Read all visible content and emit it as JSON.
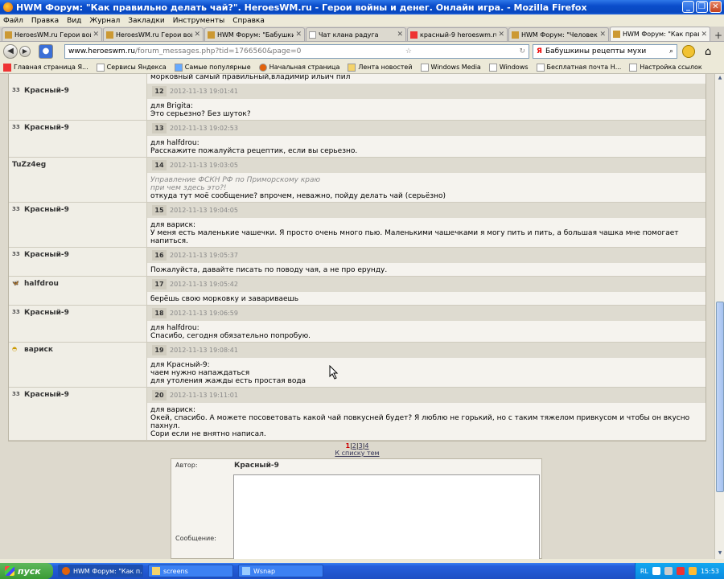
{
  "window": {
    "title": "HWM Форум: \"Как правильно делать чай?\". HeroesWM.ru - Герои войны и денег. Онлайн игра. - Mozilla Firefox"
  },
  "menu": [
    "Файл",
    "Правка",
    "Вид",
    "Журнал",
    "Закладки",
    "Инструменты",
    "Справка"
  ],
  "tabs": [
    {
      "label": "HeroesWM.ru Герои войн..."
    },
    {
      "label": "HeroesWM.ru Герои войн..."
    },
    {
      "label": "HWM Форум: \"Бабушкин..."
    },
    {
      "label": "Чат клана радуга"
    },
    {
      "label": "красный-9 heroeswm.ru-..."
    },
    {
      "label": "HWM Форум: \"Человек и..."
    },
    {
      "label": "HWM Форум: \"Как прави..."
    }
  ],
  "nav": {
    "url_domain": "www.heroeswm.ru",
    "url_path": "/forum_messages.php?tid=1766560&page=0",
    "search_value": "Бабушкины рецепты мухи"
  },
  "bookmarks": [
    "Главная страница Я...",
    "Сервисы Яндекса",
    "Самые популярные",
    "Начальная страница",
    "Лента новостей",
    "Windows Media",
    "Windows",
    "Бесплатная почта Н...",
    "Настройка ссылок"
  ],
  "top_partial_text": "морковный самый правильный,владимир ильич пил",
  "posts": [
    {
      "author": "Красный-9",
      "icon": "clan-33",
      "num": "12",
      "date": "2012-11-13 19:01:41",
      "quote": [],
      "lines": [
        "для Brigita:",
        "Это серьезно? Без шуток?"
      ]
    },
    {
      "author": "Красный-9",
      "icon": "clan-33",
      "num": "13",
      "date": "2012-11-13 19:02:53",
      "quote": [],
      "lines": [
        "для halfdrou:",
        "Расскажите пожалуйста рецептик, если вы серьезно."
      ]
    },
    {
      "author": "TuZz4eg",
      "icon": "",
      "num": "14",
      "date": "2012-11-13 19:03:05",
      "quote": [
        "Управление ФСКН РФ по Приморскому краю",
        "при чем здесь это?!"
      ],
      "lines": [
        "откуда тут моё сообщение? впрочем, неважно, пойду делать чай (серьёзно)"
      ]
    },
    {
      "author": "Красный-9",
      "icon": "clan-33",
      "num": "15",
      "date": "2012-11-13 19:04:05",
      "quote": [],
      "lines": [
        "для вариск:",
        "У меня есть маленькие чашечки. Я просто очень много пью. Маленькими чашечками я могу пить и пить, а большая чашка мне помогает напиться."
      ]
    },
    {
      "author": "Красный-9",
      "icon": "clan-33",
      "num": "16",
      "date": "2012-11-13 19:05:37",
      "quote": [],
      "lines": [
        "Пожалуйста, давайте писать по поводу чая, а не про ерунду."
      ]
    },
    {
      "author": "halfdrou",
      "icon": "clan-wing",
      "num": "17",
      "date": "2012-11-13 19:05:42",
      "quote": [],
      "lines": [
        "берёшь свою морковку и завариваешь"
      ]
    },
    {
      "author": "Красный-9",
      "icon": "clan-33",
      "num": "18",
      "date": "2012-11-13 19:06:59",
      "quote": [],
      "lines": [
        "для halfdrou:",
        "Спасибо, сегодня обязательно попробую."
      ]
    },
    {
      "author": "вариск",
      "icon": "clan-hat",
      "num": "19",
      "date": "2012-11-13 19:08:41",
      "quote": [],
      "lines": [
        "для Красный-9:",
        "чаем нужно напаждаться",
        "для утоления жажды есть простая вода"
      ]
    },
    {
      "author": "Красный-9",
      "icon": "clan-33",
      "num": "20",
      "date": "2012-11-13 19:11:01",
      "quote": [],
      "lines": [
        "для вариск:",
        "Окей, спасибо. А можете посоветовать какой чай повкусней будет? Я люблю не горький, но с таким тяжелом привкусом и чтобы он вкусно пахнул.",
        "Сори если не внятно написал."
      ]
    }
  ],
  "pager": {
    "current": "1",
    "pages": [
      "2",
      "3",
      "4"
    ],
    "back": "К списку тем"
  },
  "reply": {
    "author_label": "Автор:",
    "author_value": "Красный-9",
    "message_label": "Сообщение:"
  },
  "taskbar": {
    "start": "пуск",
    "tasks": [
      "HWM Форум: \"Как п...",
      "screens",
      "Wsnap"
    ],
    "lang": "RL",
    "clock": "15:53"
  }
}
